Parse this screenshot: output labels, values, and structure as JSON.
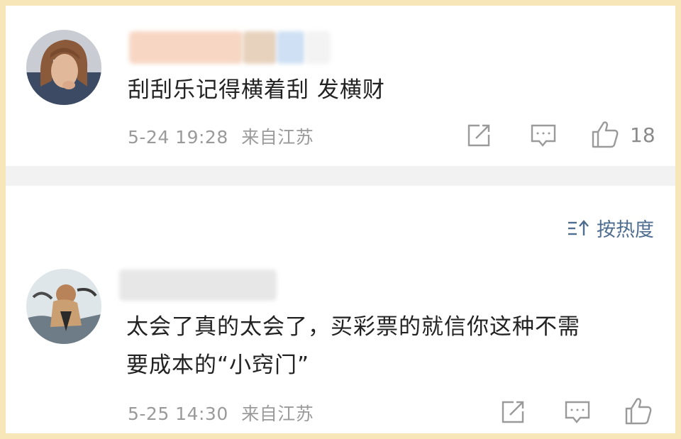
{
  "comments": [
    {
      "username": "",
      "text": "刮刮乐记得横着刮 发横财",
      "time": "5-24 19:28",
      "location": "来自江苏",
      "likes": "18"
    },
    {
      "username": "",
      "text_lines": [
        "太会了真的太会了，买彩票的就信你这种不需",
        "要成本的“小窍门”"
      ],
      "time": "5-25 14:30",
      "location": "来自江苏",
      "likes": ""
    }
  ],
  "sort": {
    "label": "按热度"
  },
  "icons": {
    "share": "share-icon",
    "comment": "comment-icon",
    "like": "thumbs-up-icon",
    "sort": "sort-icon"
  },
  "colors": {
    "frame": "#f7e6b7",
    "link": "#4f6d8f",
    "meta": "#9a9a9a",
    "divider": "#f2f2f2"
  }
}
